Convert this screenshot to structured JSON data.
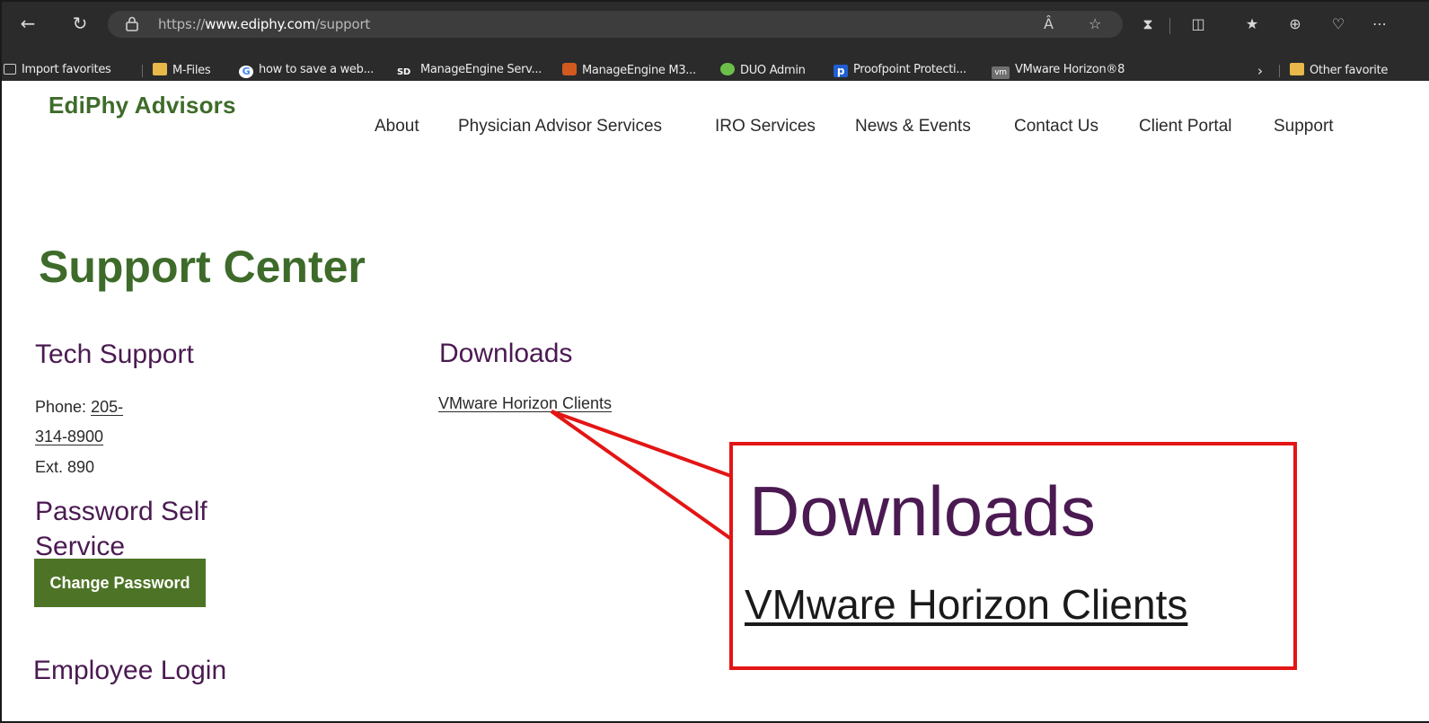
{
  "browser": {
    "url_prefix": "https://",
    "url_domain": "www.ediphy.com",
    "url_path": "/support",
    "bookmarks": [
      {
        "label": "Import favorites",
        "icon": "import-icon"
      },
      {
        "label": "M-Files",
        "icon": "folder-icon"
      },
      {
        "label": "how to save a web...",
        "icon": "google-icon"
      },
      {
        "label": "ManageEngine Serv...",
        "icon": "sd-icon"
      },
      {
        "label": "ManageEngine M3...",
        "icon": "manageengine-icon"
      },
      {
        "label": "DUO Admin",
        "icon": "duo-icon"
      },
      {
        "label": "Proofpoint Protecti...",
        "icon": "proofpoint-icon"
      },
      {
        "label": "VMware Horizon®8",
        "icon": "vmware-icon"
      },
      {
        "label": "Other favorite",
        "icon": "folder-icon"
      }
    ],
    "sd_text": "SD",
    "vm_text": "vm",
    "p_text": "p"
  },
  "site": {
    "logo": "EdiPhy Advisors",
    "nav": [
      "About",
      "Physician Advisor Services",
      "IRO Services",
      "News & Events",
      "Contact Us",
      "Client Portal",
      "Support"
    ]
  },
  "main": {
    "title": "Support Center",
    "tech_support": {
      "heading": "Tech Support",
      "phone_label": "Phone:",
      "phone_line1": "205-",
      "phone_line2": "314-8900",
      "ext": "Ext. 890"
    },
    "password": {
      "heading_line1": "Password Self",
      "heading_line2": "Service",
      "button": "Change Password"
    },
    "employee_login": "Employee Login",
    "downloads": {
      "heading": "Downloads",
      "link": "VMware Horizon Clients"
    }
  },
  "callout": {
    "heading": "Downloads",
    "link": "VMware Horizon Clients",
    "border_color": "#e31515"
  },
  "colors": {
    "brand_green": "#3e6b2a",
    "heading_purple": "#4b1a52",
    "button_green": "#4d7426"
  }
}
